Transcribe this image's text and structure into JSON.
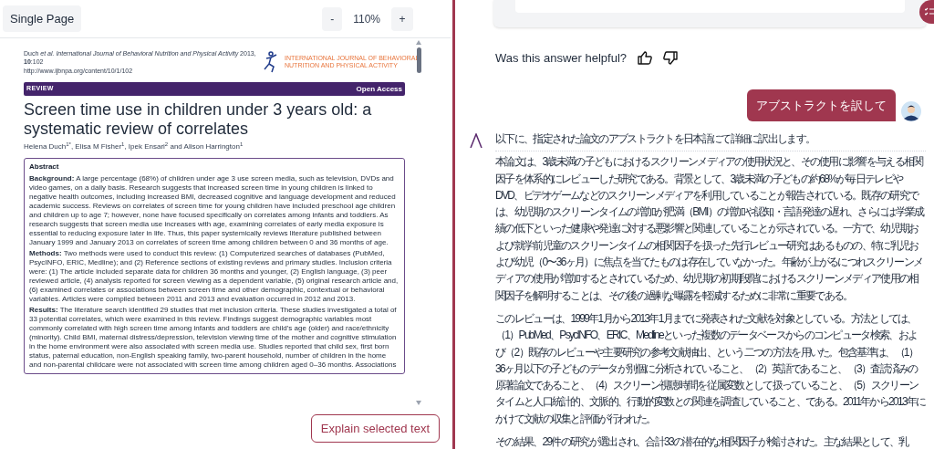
{
  "toolbar": {
    "view_mode": "Single Page",
    "zoom_out": "-",
    "zoom": "110%",
    "zoom_in": "+"
  },
  "pdf_page": {
    "citation": "Duch *et al. International Journal of Behavioral Nutrition and Physical Activity* 2013, **10**:102",
    "url": "http://www.ijbnpa.org/content/10/1/102",
    "journal_name": [
      "INTERNATIONAL JOURNAL OF BEHAVIORAL",
      "NUTRITION AND PHYSICAL ACTIVITY"
    ],
    "banner_left": "REVIEW",
    "banner_right": "Open Access",
    "title": "Screen time use in children under 3 years old: a systematic review of correlates",
    "authors": "Helena Duch$^{1*}$, Elisa M Fisher$^{1}$, Ipek Ensari$^{2}$ and Alison Harrington$^{1}$",
    "abstract": {
      "heading": "Abstract",
      "paragraphs": [
        "**Background:** A large percentage (68%) of children under age 3 use screen media, such as television, DVDs and video games, on a daily basis. Research suggests that increased screen time in young children is linked to negative health outcomes, including increased BMI, decreased cognitive and language development and reduced academic success. Reviews on correlates of screen time for young children have included preschool age children and children up to age 7; however, none have focused specifically on correlates among infants and toddlers. As research suggests that screen media use increases with age, examining correlates of early media exposure is essential to reducing exposure later in life. Thus, this paper systemically reviews literature published between January 1999 and January 2013 on correlates of screen time among children between 0 and 36 months of age.",
        "**Methods:** Two methods were used to conduct this review: (1) Computerized searches of databases (PubMed, PsycINFO, ERIC, Medline); and (2) Reference sections of existing reviews and primary studies. Inclusion criteria were: (1) The article included separate data for children 36 months and younger, (2) English language, (3) peer reviewed article, (4) analysis reported for screen viewing as a dependent variable, (5) original research article and, (6) examined correlates or associations between screen time and other demographic, contextual or behavioral variables. Articles were compiled between 2011 and 2013 and evaluation occurred in 2012 and 2013.",
        "**Results:** The literature search identified 29 studies that met inclusion criteria. These studies investigated a total of 33 potential correlates, which were examined in this review. Findings suggest demographic variables most commonly correlated with high screen time among infants and toddlers are child's age (older) and race/ethnicity (minority). Child BMI, maternal distress/depression, television viewing time of the mother and cognitive stimulation in the home environment were also associated with screen media use. Studies reported that child sex, first born status, paternal education, non-English speaking family, two-parent household, number of children in the home and non-parental childcare were not associated with screen time among children aged 0–36 months. Associations"
      ]
    }
  },
  "explain_button": "Explain selected text",
  "chat": {
    "feedback_question": "Was this answer helpful?",
    "user_message": "アブストラクトを訳して",
    "assistant": {
      "intro": "以下に、指定された論文のアブストラクトを日本語にて詳細に訳出します。",
      "paragraphs": [
        "本論文は、3歳未満の子どもにおけるスクリーンメディアの使用状況と、その使用に影響を与える相関因子を体系的にレビューした研究である。背景として、3歳未満の子どもの約68%が毎日テレビやDVD、ビデオゲームなどのスクリーンメディアを利用していることが報告されている。既存の研究では、幼児期のスクリーンタイムの増加が肥満（BMI）の増加や認知・言語発達の遅れ、さらには学業成績の低下といった健康や発達に対する悪影響と関連していることが示されている。一方で、幼児期および就学前児童のスクリーンタイムの相関因子を扱った先行レビュー研究はあるものの、特に乳児および幼児（0〜36ヶ月）に焦点を当てたものは存在していなかった。年齢が上がるにつれスクリーンメディアの使用が増加するとされているため、幼児期の初期段階におけるスクリーンメディア使用の相関因子を解明することは、その後の過剰な曝露を軽減するために非常に重要である。",
        "このレビューは、1999年1月から2013年1月までに発表された文献を対象としている。方法としては、（1）PubMed、PsycINFO、ERIC、Medlineといった複数のデータベースからのコンピュータ検索、および（2）既存のレビューや主要研究の参考文献抽出、という二つの方法を用いた。包含基準は、（1）36ヶ月以下の子どものデータが別個に分析されていること、（2）英語であること、（3）査読済みの原著論文であること、（4）スクリーン視聴時間を従属変数として扱っていること、（5）スクリーンタイムと人口統計的、文脈的、行動的変数との関連を調査していること、である。2011年から2013年にかけて文献の収集と評価が行われた。",
        "その結果、29件の研究が選出され、合計33の潜在的な相関因子が検討された。主な結果として、乳"
      ]
    }
  }
}
